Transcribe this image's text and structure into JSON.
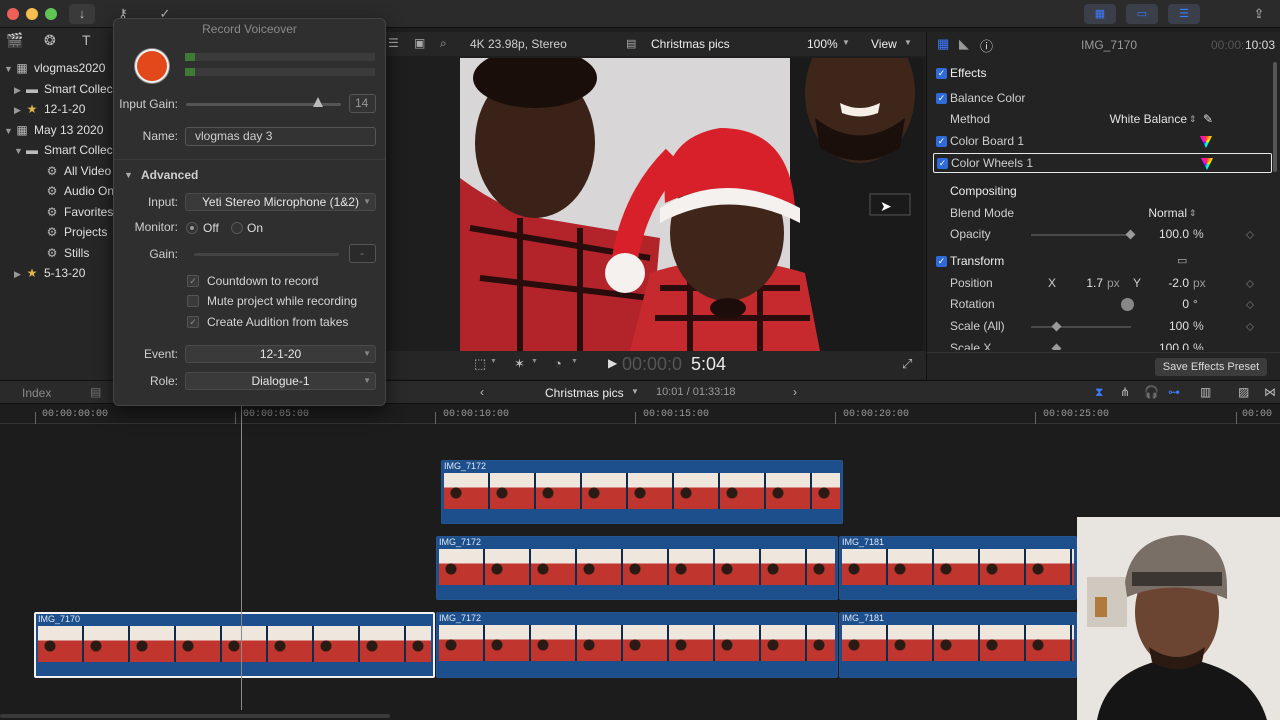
{
  "toolbar": {
    "icons": [
      "import-icon",
      "keyword-icon",
      "checkmark-icon",
      "share-icon"
    ]
  },
  "library": {
    "rows": [
      {
        "disc": "▼",
        "icon": "library",
        "label": "vlogmas2020"
      },
      {
        "disc": "▶",
        "icon": "folder",
        "label": "Smart Collec"
      },
      {
        "disc": "▶",
        "icon": "event",
        "label": "12-1-20"
      },
      {
        "disc": "▼",
        "icon": "library",
        "label": "May 13 2020"
      },
      {
        "disc": "▼",
        "icon": "folder",
        "label": "Smart Collec"
      },
      {
        "disc": "",
        "icon": "gear",
        "label": "All Video"
      },
      {
        "disc": "",
        "icon": "gear",
        "label": "Audio Only"
      },
      {
        "disc": "",
        "icon": "gear",
        "label": "Favorites"
      },
      {
        "disc": "",
        "icon": "gear",
        "label": "Projects"
      },
      {
        "disc": "",
        "icon": "gear",
        "label": "Stills"
      },
      {
        "disc": "▶",
        "icon": "event",
        "label": "5-13-20"
      }
    ]
  },
  "voiceover": {
    "title": "Record Voiceover",
    "input_gain_label": "Input Gain:",
    "input_gain_value": "14",
    "input_gain_level": 0.85,
    "name_label": "Name:",
    "name_value": "vlogmas day 3",
    "advanced_label": "Advanced",
    "input_label": "Input:",
    "input_value": "Yeti Stereo Microphone (1&2)",
    "monitor_label": "Monitor:",
    "monitor_off": "Off",
    "monitor_on": "On",
    "monitor_selected": "Off",
    "gain_label": "Gain:",
    "gain_value": "-",
    "options": [
      {
        "label": "Countdown to record",
        "checked": true
      },
      {
        "label": "Mute project while recording",
        "checked": false
      },
      {
        "label": "Create Audition from takes",
        "checked": true
      }
    ],
    "event_label": "Event:",
    "event_value": "12-1-20",
    "role_label": "Role:",
    "role_value": "Dialogue-1"
  },
  "viewer": {
    "format": "4K 23.98p, Stereo",
    "project": "Christmas pics",
    "zoom": "100%",
    "view_label": "View",
    "timecode": "5:04",
    "timecode_dim": "00:00:0"
  },
  "inspector": {
    "clip_name": "IMG_7170",
    "duration_dim": "00:00:",
    "duration": "10:03",
    "effects_label": "Effects",
    "balance_color": "Balance Color",
    "method_label": "Method",
    "method_value": "White Balance",
    "color_board": "Color Board 1",
    "color_wheels": "Color Wheels 1",
    "compositing_label": "Compositing",
    "blend_mode_label": "Blend Mode",
    "blend_mode_value": "Normal",
    "opacity_label": "Opacity",
    "opacity_value": "100.0",
    "opacity_unit": "%",
    "transform_label": "Transform",
    "position_label": "Position",
    "pos_x_label": "X",
    "pos_x_value": "1.7",
    "pos_unit": "px",
    "pos_y_label": "Y",
    "pos_y_value": "-2.0",
    "rotation_label": "Rotation",
    "rotation_value": "0",
    "rotation_unit": "°",
    "scale_all_label": "Scale (All)",
    "scale_all_value": "100",
    "scale_unit": "%",
    "scale_x_label": "Scale X",
    "scale_x_value": "100.0",
    "save_preset": "Save Effects Preset"
  },
  "timeline": {
    "index_label": "Index",
    "project": "Christmas pics",
    "position": "10:01 / 01:33:18",
    "ruler": [
      "00:00:00:00",
      "00:00:05:00",
      "00:00:10:00",
      "00:00:15:00",
      "00:00:20:00",
      "00:00:25:00",
      "00:00"
    ],
    "clips": {
      "top": "IMG_7172",
      "mid_a": "IMG_7172",
      "mid_b": "IMG_7181",
      "main_a": "IMG_7170",
      "main_b": "IMG_7172",
      "main_c": "IMG_7181"
    }
  },
  "colors": {
    "accent": "#2f6bd8",
    "record": "#e2481a",
    "clip": "#1d4f8c"
  }
}
